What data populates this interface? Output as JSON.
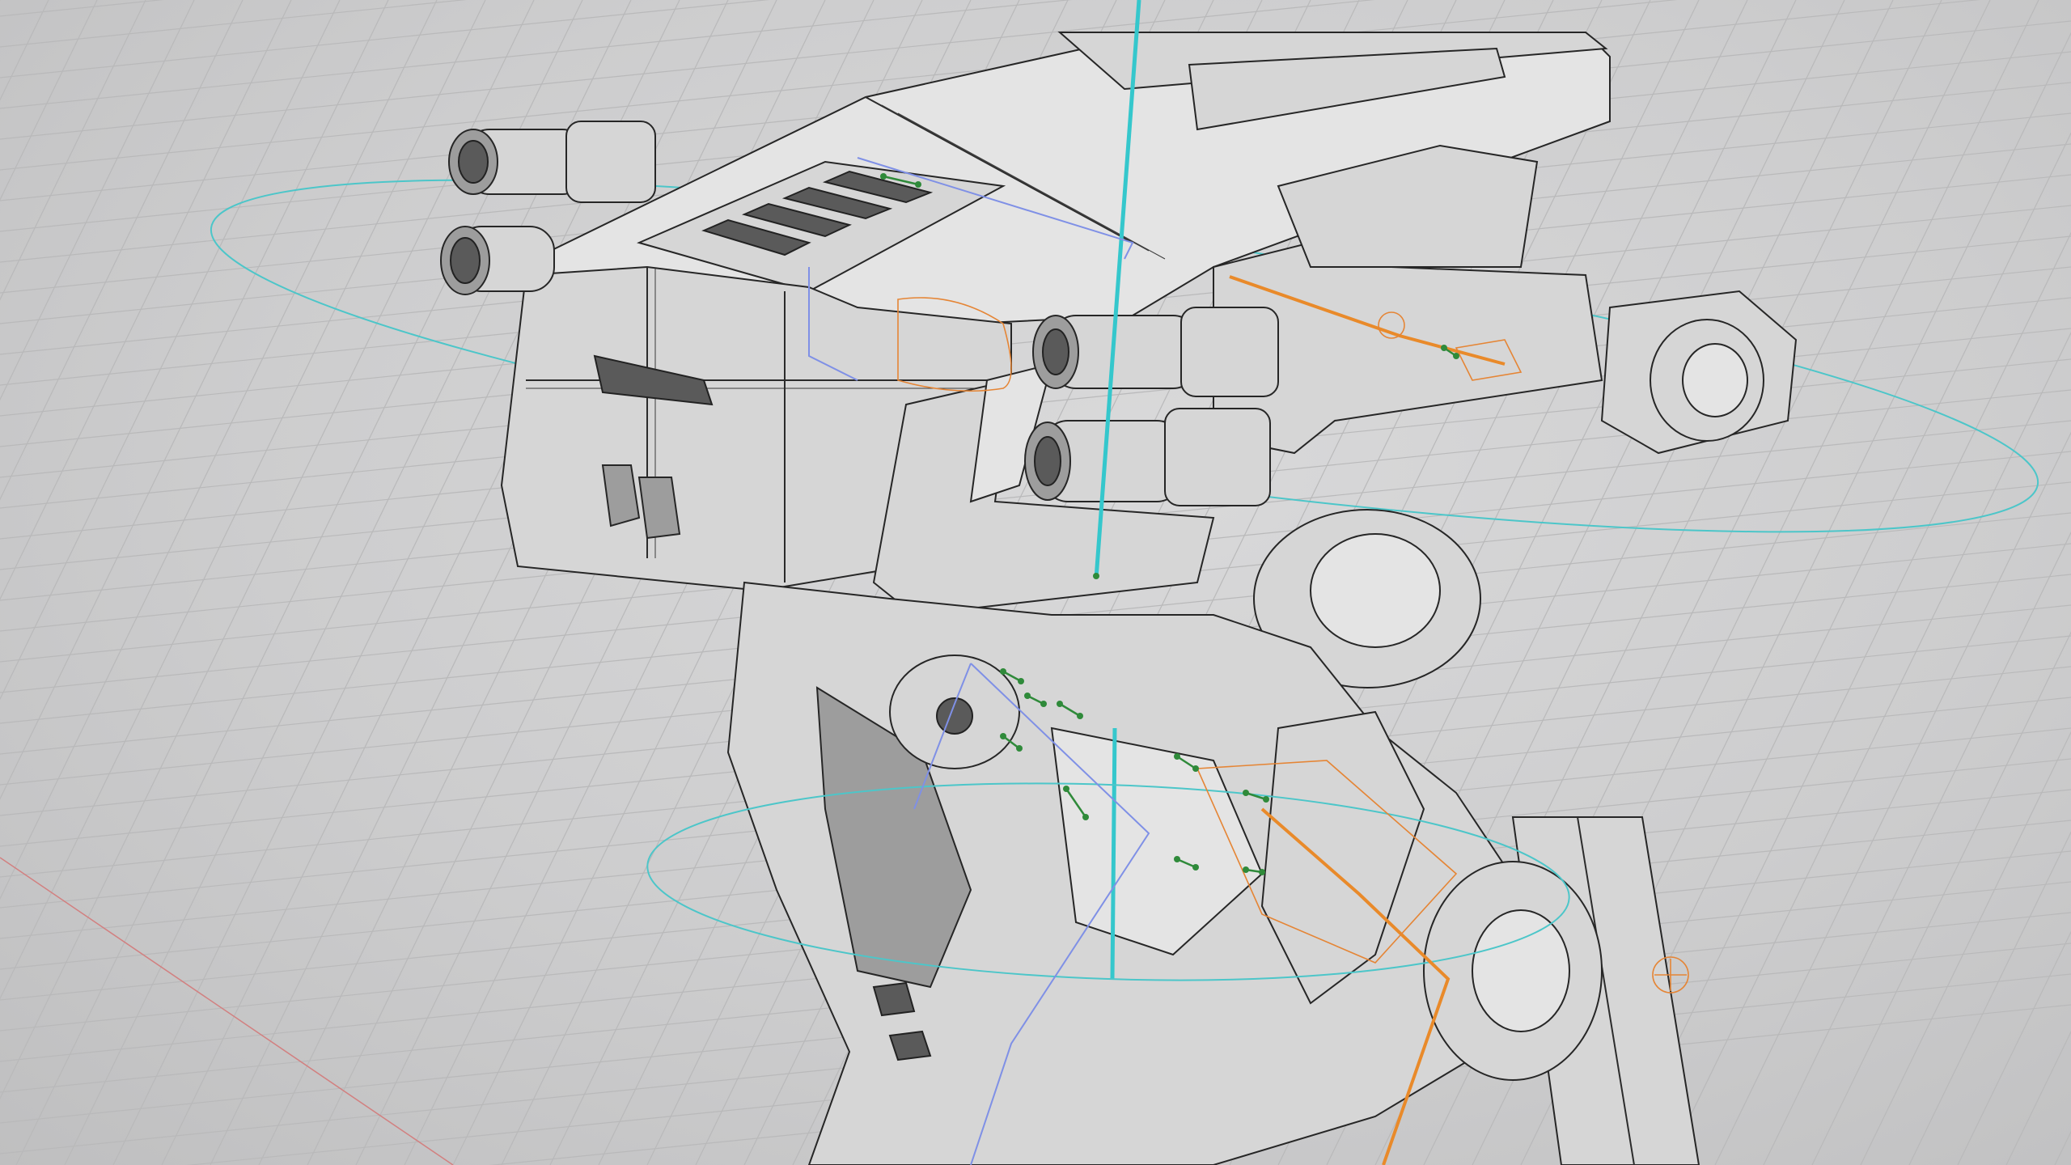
{
  "viewport": {
    "type": "3d-modeling-viewport",
    "display_mode": "wireframe-on-shaded",
    "background_color": "#cfcfd0",
    "grid": true,
    "model": "mech-robot",
    "rig_colors": {
      "controls": "#4cc6c9",
      "bones": "#e98a2a",
      "joints": "#2f8a3a",
      "selection": "#7f90e6"
    }
  }
}
